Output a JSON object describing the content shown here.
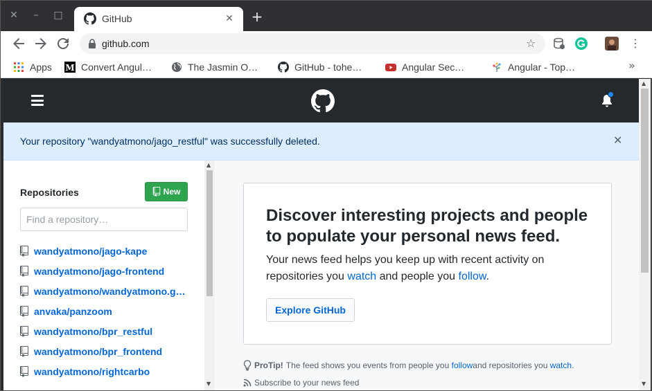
{
  "browser": {
    "tab": {
      "title": "GitHub",
      "close": "✕"
    },
    "window_buttons": {
      "close": "✕",
      "minimize": "–",
      "maximize": "□"
    },
    "new_tab": "+",
    "url": "github.com",
    "star": "☆",
    "menu": "⋮"
  },
  "bookmarks": {
    "items": [
      {
        "label": "Apps",
        "icon": "apps-grid-icon"
      },
      {
        "label": "Convert Angul…",
        "icon": "medium-icon"
      },
      {
        "label": "The Jasmin O…",
        "icon": "globe-icon"
      },
      {
        "label": "GitHub - tohe…",
        "icon": "github-icon"
      },
      {
        "label": "Angular Sec…",
        "icon": "youtube-icon"
      },
      {
        "label": "Angular - Top…",
        "icon": "angular-tree-icon"
      }
    ],
    "more": "»"
  },
  "flash": {
    "message": "Your repository \"wandyatmono/jago_restful\" was successfully deleted.",
    "close": "✕"
  },
  "sidebar": {
    "title": "Repositories",
    "new_button": "New",
    "search_placeholder": "Find a repository…",
    "repos": [
      "wandyatmono/jago-kape",
      "wandyatmono/jago-frontend",
      "wandyatmono/wandyatmono.g…",
      "anvaka/panzoom",
      "wandyatmono/bpr_restful",
      "wandyatmono/bpr_frontend",
      "wandyatmono/rightcarbo"
    ]
  },
  "main": {
    "discover_title": "Discover interesting projects and people to populate your personal news feed.",
    "body_1": "Your news feed helps you keep up with recent activity on repositories you ",
    "watch_link": "watch",
    "body_2": " and people you ",
    "follow_link": "follow",
    "body_3": ".",
    "explore_button": "Explore GitHub",
    "protip_label": "ProTip!",
    "protip_1": " The feed shows you events from people you ",
    "protip_follow": "follow",
    "protip_2": " and repositories you ",
    "protip_watch": "watch",
    "protip_3": ".",
    "subscribe": "Subscribe to your news feed"
  },
  "colors": {
    "header": "#24292e",
    "link": "#0366d6",
    "new_button": "#2ea44f",
    "flash_bg": "#dbedff"
  }
}
